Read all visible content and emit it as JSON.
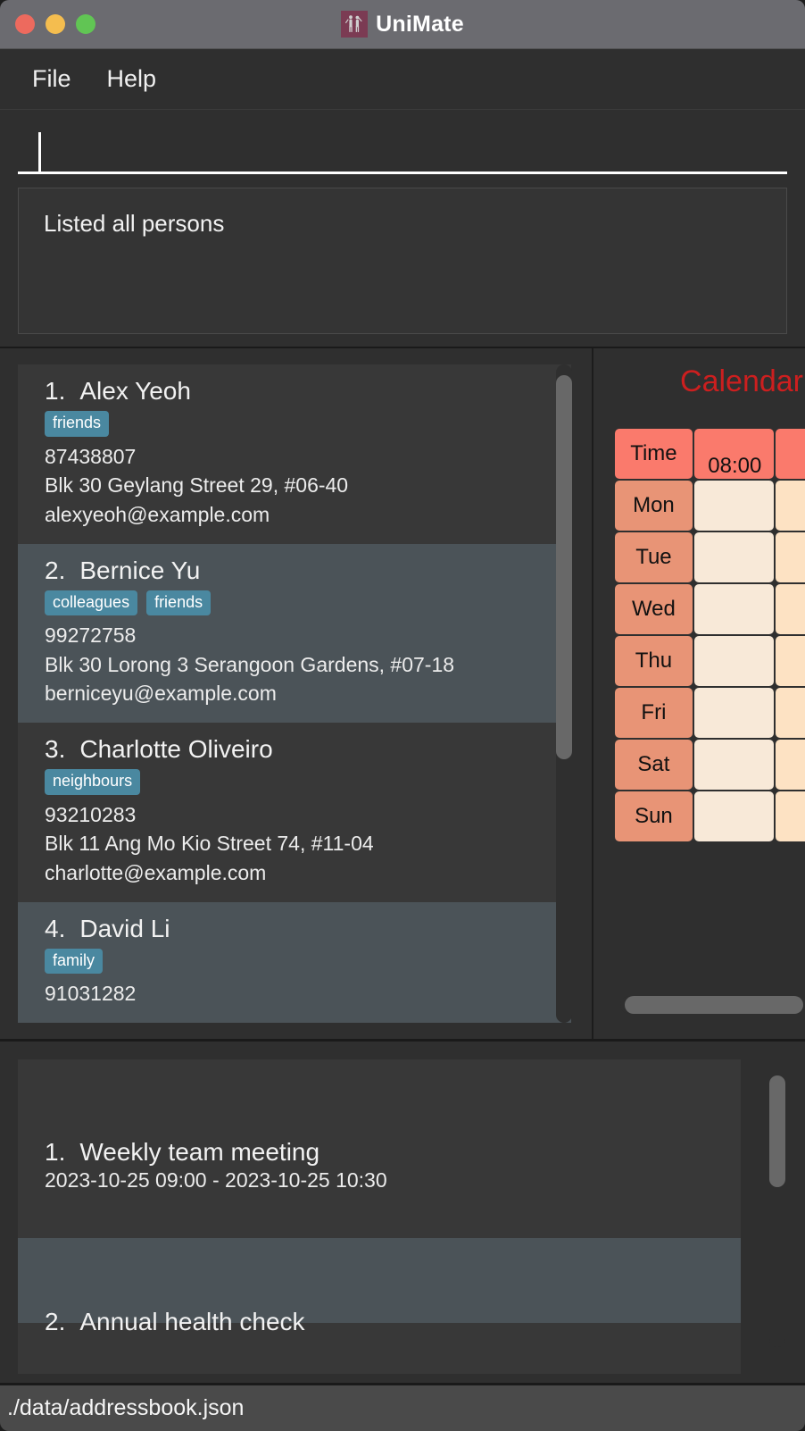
{
  "window": {
    "title": "UniMate",
    "app_icon": "two-people-icon",
    "traffic_lights": [
      "close-button",
      "minimize-button",
      "maximize-button"
    ],
    "colors": {
      "titlebar": "#6b6b70",
      "app_icon_bg": "#7b3b53",
      "close": "#ed6a5e",
      "minimize": "#f4bd4f",
      "maximize": "#61c554",
      "tag": "#4a88a0",
      "calendar_title": "#cc1f1f",
      "cal_header": "#fa7a6c",
      "cal_dayhead": "#e89476"
    }
  },
  "menubar": {
    "items": [
      {
        "label": "File"
      },
      {
        "label": "Help"
      }
    ]
  },
  "command": {
    "value": "",
    "placeholder": ""
  },
  "result": {
    "text": "Listed all persons"
  },
  "persons": {
    "items": [
      {
        "index": "1.",
        "name": "Alex Yeoh",
        "tags": [
          "friends"
        ],
        "phone": "87438807",
        "address": "Blk 30 Geylang Street 29, #06-40",
        "email": "alexyeoh@example.com"
      },
      {
        "index": "2.",
        "name": "Bernice Yu",
        "tags": [
          "colleagues",
          "friends"
        ],
        "phone": "99272758",
        "address": "Blk 30 Lorong 3 Serangoon Gardens, #07-18",
        "email": "berniceyu@example.com"
      },
      {
        "index": "3.",
        "name": "Charlotte Oliveiro",
        "tags": [
          "neighbours"
        ],
        "phone": "93210283",
        "address": "Blk 11 Ang Mo Kio Street 74, #11-04",
        "email": "charlotte@example.com"
      },
      {
        "index": "4.",
        "name": "David Li",
        "tags": [
          "family"
        ],
        "phone": "91031282",
        "address": "",
        "email": ""
      }
    ]
  },
  "calendar": {
    "title": "Calendar",
    "time_header": "Time",
    "columns": [
      "08:00"
    ],
    "days": [
      "Mon",
      "Tue",
      "Wed",
      "Thu",
      "Fri",
      "Sat",
      "Sun"
    ]
  },
  "events": {
    "items": [
      {
        "index": "1.",
        "title": "Weekly team meeting",
        "range": "2023-10-25 09:00 - 2023-10-25 10:30"
      },
      {
        "index": "2.",
        "title": "Annual health check",
        "range": ""
      }
    ]
  },
  "status": {
    "path": "./data/addressbook.json"
  }
}
